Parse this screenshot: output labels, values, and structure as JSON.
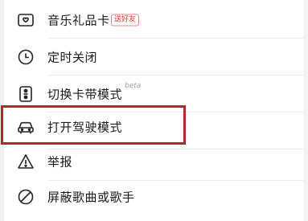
{
  "menu": {
    "items": [
      {
        "label": "音乐礼品卡",
        "icon": "gift-card-icon",
        "badge": "送好友"
      },
      {
        "label": "定时关闭",
        "icon": "clock-icon"
      },
      {
        "label": "切换卡带模式",
        "icon": "cassette-icon",
        "tag": "beta"
      },
      {
        "label": "打开驾驶模式",
        "icon": "car-icon",
        "highlighted": true
      },
      {
        "label": "举报",
        "icon": "warning-icon"
      },
      {
        "label": "屏蔽歌曲或歌手",
        "icon": "block-icon"
      }
    ]
  },
  "colors": {
    "highlight_border": "#b0282b",
    "badge": "#d33a31"
  }
}
